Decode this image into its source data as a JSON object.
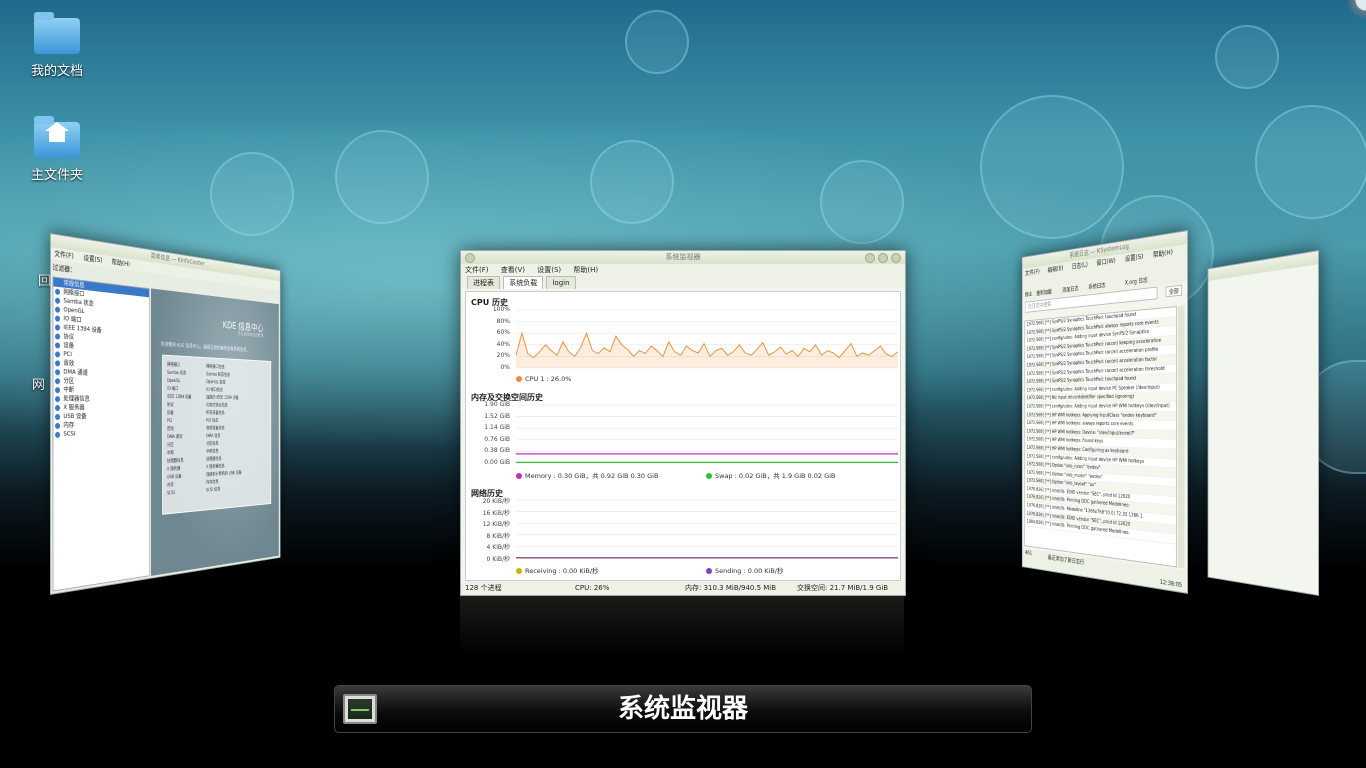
{
  "desktop": {
    "icons": [
      {
        "label": "我的文档"
      },
      {
        "label": "主文件夹"
      }
    ],
    "partial_labels": [
      "回",
      "网"
    ]
  },
  "left_window": {
    "title": "菜单信息 — KInfoCenter",
    "menu": [
      "文件(F)",
      "设置(S)",
      "帮助(H)"
    ],
    "filter_label": "过滤器：",
    "tree": [
      "常规信息",
      "网络接口",
      "Samba 状态",
      "OpenGL",
      "IO 端口",
      "IEEE 1394 设备",
      "协议",
      "设备",
      "PCI",
      "音效",
      "DMA 通道",
      "分区",
      "中断",
      "处理器信息",
      "X 服务器",
      "USB 设备",
      "内存",
      "SCSI"
    ],
    "header_title": "KDE 信息中心",
    "header_sub": "有关系统的信息概览",
    "welcome": "欢迎使用 KDE 信息中心，选择左侧的模块查看系统信息。",
    "panel_left": [
      "网络接口",
      "Samba 状态",
      "OpenGL",
      "IO 端口",
      "IEEE 1394 设备",
      "协议",
      "设备",
      "PCI",
      "音效",
      "DMA 通道",
      "分区",
      "中断",
      "处理器信息",
      "X 服务器",
      "USB 设备",
      "内存",
      "SCSI"
    ],
    "panel_right": [
      "网络接口信息",
      "Samba 状态信息",
      "OpenGL 信息",
      "IO 端口信息",
      "连接的 IEEE 1394 设备",
      "可用的协议信息",
      "所有设备信息",
      "PCI 信息",
      "音频设备信息",
      "DMA 信息",
      "分区信息",
      "中断信息",
      "处理器信息",
      "X 服务器信息",
      "连接到计算机的 USB 设备",
      "内存信息",
      "SCSI 信息"
    ]
  },
  "center_window": {
    "title": "系统监视器",
    "menu": [
      "文件(F)",
      "查看(V)",
      "设置(S)",
      "帮助(H)"
    ],
    "tabs": [
      "进程表",
      "系统负载",
      "login"
    ],
    "active_tab": "系统负载",
    "cpu_title": "CPU 历史",
    "cpu_ticks": [
      "100%",
      "80%",
      "60%",
      "40%",
      "20%",
      "0%"
    ],
    "cpu_legend": "CPU 1 : 26.0%",
    "cpu_color": "#f08a30",
    "mem_title": "内存及交换空间历史",
    "mem_ticks": [
      "1.90 GiB",
      "1.52 GiB",
      "1.14 GiB",
      "0.76 GiB",
      "0.38 GiB",
      "0.00 GiB"
    ],
    "mem_legend": "Memory : 0.30 GiB，共 0.92 GiB 0.30 GiB",
    "swap_legend": "Swap : 0.02 GiB，共 1.9 GiB 0.02 GiB",
    "mem_color": "#c030c0",
    "swap_color": "#30c030",
    "net_title": "网络历史",
    "net_ticks": [
      "20 KiB/秒",
      "16 KiB/秒",
      "12 KiB/秒",
      "8 KiB/秒",
      "4 KiB/秒",
      "0 KiB/秒"
    ],
    "recv_legend": "Receiving : 0.00 KiB/秒",
    "send_legend": "Sending : 0.00 KiB/秒",
    "recv_color": "#d0b000",
    "send_color": "#8040c0",
    "status": {
      "processes": "128 个进程",
      "cpu": "CPU: 26%",
      "memory": "内存: 310.3 MiB/940.5 MiB",
      "swap": "交换空间: 21.7 MiB/1.9 GiB"
    },
    "cpu_series": [
      22,
      60,
      25,
      18,
      28,
      40,
      30,
      22,
      45,
      28,
      20,
      35,
      60,
      30,
      25,
      35,
      28,
      55,
      40,
      32,
      20,
      30,
      25,
      38,
      30,
      20,
      45,
      28,
      22,
      38,
      30,
      26,
      42,
      20,
      30,
      34,
      22,
      28,
      40,
      26,
      22,
      32,
      44,
      22,
      28,
      36,
      24,
      30,
      20,
      34,
      28,
      40,
      22,
      30,
      26,
      18,
      30,
      42,
      20,
      26,
      22,
      30,
      38,
      24,
      20,
      28
    ]
  },
  "right_window": {
    "title": "系统日志 — KSystemLog",
    "menu": [
      "文件(F)",
      "编辑(E)",
      "日志(L)",
      "窗口(W)",
      "设置(S)",
      "帮助(H)"
    ],
    "toolbar": [
      "停止",
      "重新加载",
      "添加日志",
      "系统日志",
      "X.org 日志"
    ],
    "search_placeholder": "在日志中搜索",
    "filter": "全部",
    "lines": [
      "1972.568] [**] SynPS/2 Synaptics TouchPad: touchpad found",
      "1972.568] [**] SynPS/2 Synaptics TouchPad: always reports core events",
      "1972.568] [**] config/udev: Adding input device SynPS/2 Synaptics",
      "1972.568] [**] SynPS/2 Synaptics TouchPad: (accel) keeping acceleration",
      "1972.568] [**] SynPS/2 Synaptics TouchPad: (accel) acceleration profile",
      "1972.568] [**] SynPS/2 Synaptics TouchPad: (accel) acceleration factor",
      "1972.568] [**] SynPS/2 Synaptics TouchPad: (accel) acceleration threshold",
      "1972.568] [**] SynPS/2 Synaptics TouchPad: touchpad found",
      "1972.568] [**] config/udev: Adding input device PC Speaker (/dev/input)",
      "1972.568] [**] No input driver/identifier specified (ignoring)",
      "1972.568] [**] config/udev: Adding input device HP WMI hotkeys (/dev/input)",
      "1972.568] [**] HP WMI hotkeys: Applying InputClass \"evdev keyboard\"",
      "1972.568] [**] HP WMI hotkeys: always reports core events",
      "1972.568] [**] HP WMI hotkeys: Device: \"/dev/input/event7\"",
      "1972.568] [**] HP WMI hotkeys: Found keys",
      "1972.568] [**] HP WMI hotkeys: Configuring as keyboard",
      "1972.568] [**] config/udev: Adding input device HP WMI hotkeys",
      "1972.568] [**] Option \"xkb_rules\" \"evdev\"",
      "1972.568] [**] Option \"xkb_model\" \"evdev\"",
      "1972.568] [**] Option \"xkb_layout\" \"us\"",
      "1976.826] [**] intel(0): EDID vendor \"SEC\", prod id 12620",
      "1976.826] [**] intel(0): Printing DDC gathered Modelines:",
      "1976.826] [**] intel(0): Modeline \"1366x768\"(0.0)  72.33  1366 1",
      "1976.826] [**] intel(0): EDID vendor \"SEC\", prod id 12620",
      "1984.828] [**] intel(0): Printing DDC gathered Modelines:"
    ],
    "lines_count": "461",
    "footer_label": "最近添加了新日志行",
    "clock": "12:38:05"
  },
  "switcher": {
    "label": "系统监视器"
  }
}
